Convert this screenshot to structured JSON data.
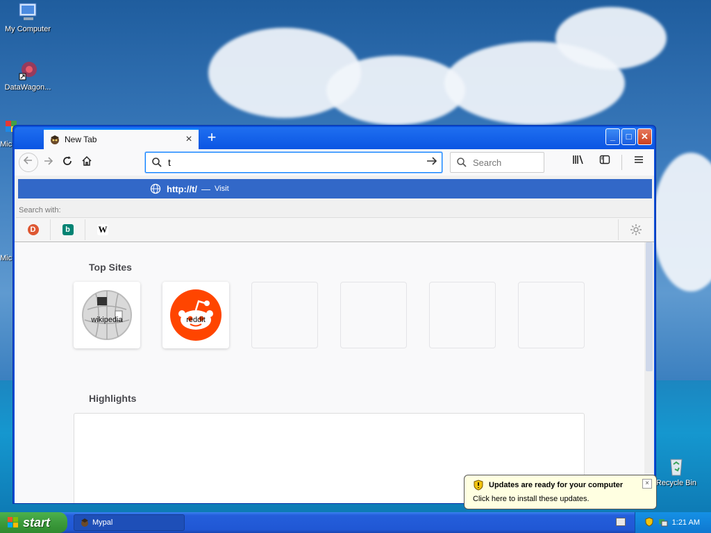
{
  "desktop": {
    "icons": [
      {
        "label": "My Computer"
      },
      {
        "label": "DataWagon..."
      },
      {
        "label": "Mic"
      },
      {
        "label": "Mic"
      },
      {
        "label": "Recycle Bin"
      }
    ]
  },
  "browser": {
    "tab_title": "New Tab",
    "tab_close": "×",
    "new_tab": "+",
    "window_buttons": {
      "minimize": "_",
      "maximize": "□",
      "close": "✕"
    },
    "url_value": "t",
    "search_placeholder": "Search",
    "suggestion": {
      "url": "http://t/",
      "dash": "—",
      "action": "Visit"
    },
    "search_with_label": "Search with:",
    "engines": [
      {
        "name": "DuckDuckGo",
        "glyph": "D",
        "color": "#de5833"
      },
      {
        "name": "Bing",
        "glyph": "b",
        "color": "#008373"
      },
      {
        "name": "Wikipedia",
        "glyph": "W",
        "color": "#ffffff"
      }
    ],
    "content": {
      "top_sites_title": "Top Sites",
      "top_sites": [
        {
          "label": "wikipedia"
        },
        {
          "label": "reddit"
        },
        {
          "label": ""
        },
        {
          "label": ""
        },
        {
          "label": ""
        },
        {
          "label": ""
        }
      ],
      "highlights_title": "Highlights"
    }
  },
  "notification": {
    "title": "Updates are ready for your computer",
    "text": "Click here to install these updates.",
    "close": "×"
  },
  "taskbar": {
    "start_label": "start",
    "task_label": "Mypal",
    "clock": "1:21 AM"
  },
  "colors": {
    "accent": "#0a84ff",
    "suggestion_bg": "#3268c8",
    "reddit": "#ff4500",
    "xp_blue": "#245edb",
    "start_green": "#3c9b3c"
  }
}
